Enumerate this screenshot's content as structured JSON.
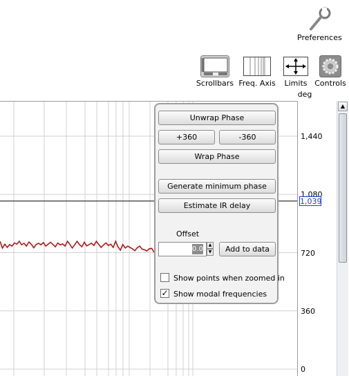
{
  "toolbar": {
    "preferences_label": "Preferences",
    "scrollbars_label": "Scrollbars",
    "freq_axis_label": "Freq. Axis",
    "limits_label": "Limits",
    "controls_label": "Controls",
    "unit_label": "deg"
  },
  "axis": {
    "y_ticks": [
      "1,440",
      "1,080",
      "720",
      "360",
      "0"
    ],
    "cursor_value": "1,039"
  },
  "panel": {
    "unwrap_phase": "Unwrap Phase",
    "plus_360": "+360",
    "minus_360": "-360",
    "wrap_phase": "Wrap Phase",
    "generate_min_phase": "Generate minimum phase",
    "estimate_ir_delay": "Estimate IR delay",
    "offset_label": "Offset",
    "offset_value": "0.0",
    "add_to_data": "Add to data",
    "show_points_label": "Show points when zoomed in",
    "show_points_checked": false,
    "show_modal_label": "Show modal frequencies",
    "show_modal_checked": true
  },
  "colors": {
    "trace": "#b01818",
    "trace_faded": "#e8a0a0",
    "cursor_box": "#1b3fd3",
    "grid": "#d0d0d0"
  },
  "chart_data": {
    "type": "line",
    "ylabel": "deg",
    "ylim": [
      0,
      1620
    ],
    "y_ticks": [
      0,
      360,
      720,
      1080,
      1440
    ],
    "cursor_y": 1039,
    "series": [
      {
        "values": [
          790,
          748,
          772,
          752,
          770,
          760,
          780,
          772,
          790,
          768,
          778,
          760,
          786,
          772,
          750,
          770,
          778,
          768,
          782,
          760,
          772,
          784,
          770,
          756,
          780,
          768,
          774,
          760,
          790,
          772,
          748,
          768,
          790,
          770,
          756,
          784,
          762,
          770,
          778,
          764,
          790,
          770,
          752,
          768,
          780,
          764,
          772,
          752,
          790,
          756,
          735,
          770,
          748,
          760,
          752,
          744,
          732,
          750,
          760,
          742,
          738,
          730,
          744,
          746,
          722
        ]
      },
      {
        "values": [
          712,
          700,
          690,
          706,
          688,
          684,
          698,
          690,
          672,
          686,
          676
        ]
      }
    ]
  }
}
